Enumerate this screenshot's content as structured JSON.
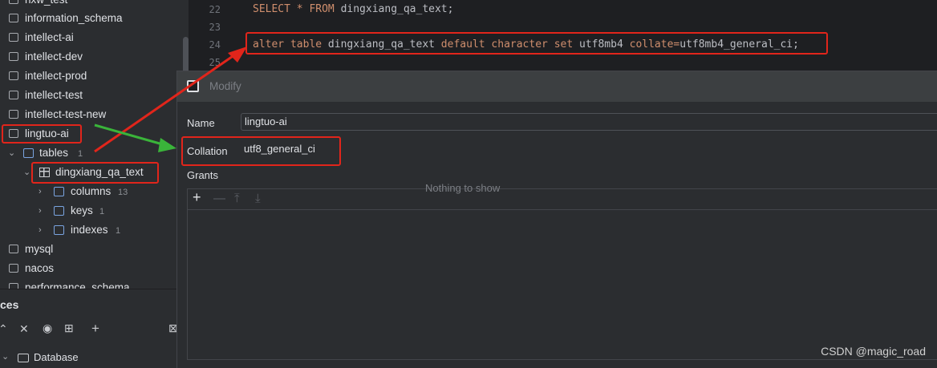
{
  "tree": {
    "items": [
      {
        "label": "nxw_test",
        "kind": "db"
      },
      {
        "label": "information_schema",
        "kind": "db"
      },
      {
        "label": "intellect-ai",
        "kind": "db"
      },
      {
        "label": "intellect-dev",
        "kind": "db"
      },
      {
        "label": "intellect-prod",
        "kind": "db"
      },
      {
        "label": "intellect-test",
        "kind": "db"
      },
      {
        "label": "intellect-test-new",
        "kind": "db"
      },
      {
        "label": "lingtuo-ai",
        "kind": "db"
      },
      {
        "label": "tables",
        "kind": "folder",
        "count": "1"
      },
      {
        "label": "dingxiang_qa_text",
        "kind": "table"
      },
      {
        "label": "columns",
        "kind": "folder",
        "count": "13"
      },
      {
        "label": "keys",
        "kind": "folder",
        "count": "1"
      },
      {
        "label": "indexes",
        "kind": "folder",
        "count": "1"
      },
      {
        "label": "mysql",
        "kind": "db"
      },
      {
        "label": "nacos",
        "kind": "db"
      },
      {
        "label": "performance_schema",
        "kind": "db"
      }
    ]
  },
  "services": {
    "title": "ces",
    "tree_root": "Database"
  },
  "editor": {
    "lines": [
      {
        "num": "22",
        "text_kw": "SELECT * FROM ",
        "text_id": "dingxiang_qa_text;"
      },
      {
        "num": "23",
        "text": ""
      },
      {
        "num": "24",
        "parts": [
          "alter table ",
          "dingxiang_qa_text",
          " default character set ",
          "utf8mb4",
          " collate=",
          "utf8mb4_general_ci;"
        ]
      },
      {
        "num": "25",
        "text": ""
      }
    ]
  },
  "dialog": {
    "title": "Modify",
    "name_label": "Name",
    "name_value": "lingtuo-ai",
    "collation_label": "Collation",
    "collation_value": "utf8_general_ci",
    "grants_label": "Grants",
    "empty_text": "Nothing to show"
  },
  "watermark": "CSDN @magic_road",
  "colors": {
    "annotation_red": "#e1251b",
    "annotation_green": "#3ab43a",
    "keyword": "#cf8e6d"
  }
}
